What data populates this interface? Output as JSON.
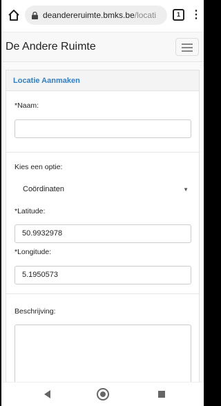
{
  "browser": {
    "url_host": "deandereruimte.bmks.be",
    "url_path": "/locati",
    "tab_count": "1",
    "menu_glyph": "⋮"
  },
  "navbar": {
    "brand": "De Andere Ruimte"
  },
  "form": {
    "title": "Locatie Aanmaken",
    "naam_label": "*Naam:",
    "naam_value": "",
    "option_label": "Kies een optie:",
    "option_selected": "Coördinaten",
    "latitude_label": "*Latitude:",
    "latitude_value": "50.9932978",
    "longitude_label": "*Longitude:",
    "longitude_value": "5.1950573",
    "description_label": "Beschrijving:",
    "description_value": ""
  },
  "colors": {
    "accent": "#2f80c7"
  },
  "icons": [
    "home-icon",
    "lock-icon",
    "tabs-icon",
    "overflow-menu-icon",
    "hamburger-icon",
    "back-icon",
    "home-circle-icon",
    "recent-apps-icon",
    "select-caret-icon"
  ]
}
